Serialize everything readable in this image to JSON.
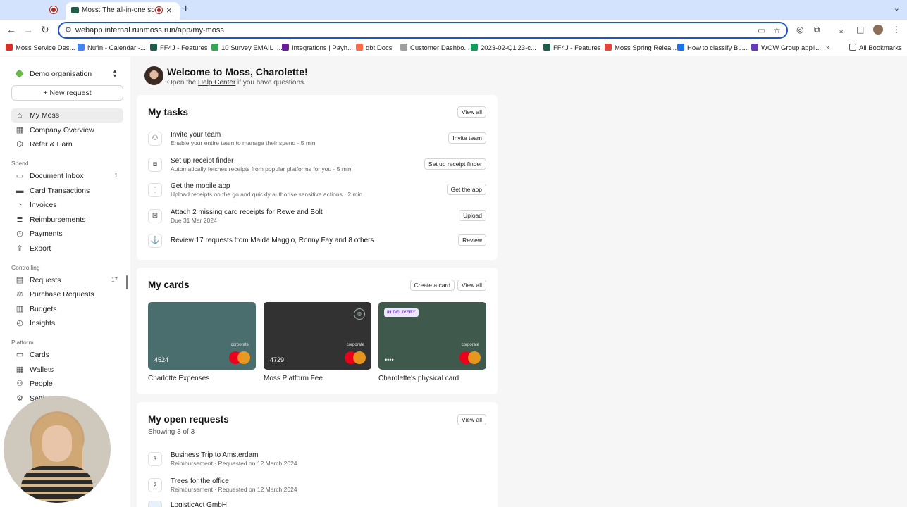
{
  "browser": {
    "tab_title": "Moss: The all-in-one spend",
    "url": "webapp.internal.runmoss.run/app/my-moss",
    "bookmarks": [
      {
        "label": "Moss Service Des...",
        "color": "#d93025"
      },
      {
        "label": "Nufin - Calendar -...",
        "color": "#4285f4"
      },
      {
        "label": "FF4J - Features",
        "color": "#1e5d4a"
      },
      {
        "label": "10 Survey EMAIL I...",
        "color": "#34a853"
      },
      {
        "label": "Integrations | Payh...",
        "color": "#6a1b9a"
      },
      {
        "label": "dbt Docs",
        "color": "#ff694a"
      },
      {
        "label": "Customer Dashbo...",
        "color": "#9e9e9e"
      },
      {
        "label": "2023-02-Q1'23-c...",
        "color": "#0f9d58"
      },
      {
        "label": "FF4J - Features",
        "color": "#1e5d4a"
      },
      {
        "label": "Moss Spring Relea...",
        "color": "#e8453c"
      },
      {
        "label": "How to classify Bu...",
        "color": "#1a73e8"
      },
      {
        "label": "WOW Group appli...",
        "color": "#673ab7"
      }
    ],
    "all_bookmarks": "All Bookmarks",
    "more_bookmarks": "»"
  },
  "sidebar": {
    "org_name": "Demo organisation",
    "new_request": "New request",
    "main_items": [
      {
        "label": "My Moss",
        "icon": "home"
      },
      {
        "label": "Company Overview",
        "icon": "building"
      },
      {
        "label": "Refer & Earn",
        "icon": "gift"
      }
    ],
    "spend_label": "Spend",
    "spend_items": [
      {
        "label": "Document Inbox",
        "count": "1"
      },
      {
        "label": "Card Transactions"
      },
      {
        "label": "Invoices"
      },
      {
        "label": "Reimbursements"
      },
      {
        "label": "Payments"
      },
      {
        "label": "Export"
      }
    ],
    "controlling_label": "Controlling",
    "controlling_items": [
      {
        "label": "Requests",
        "count": "17"
      },
      {
        "label": "Purchase Requests"
      },
      {
        "label": "Budgets"
      },
      {
        "label": "Insights"
      }
    ],
    "platform_label": "Platform",
    "platform_items": [
      {
        "label": "Cards"
      },
      {
        "label": "Wallets"
      },
      {
        "label": "People"
      },
      {
        "label": "Settings"
      }
    ]
  },
  "welcome": {
    "title": "Welcome to Moss, Charolette!",
    "sub_before": "Open the ",
    "sub_link": "Help Center",
    "sub_after": " if you have questions."
  },
  "tasks": {
    "title": "My tasks",
    "view_all": "View all",
    "items": [
      {
        "title": "Invite your team",
        "subtitle": "Enable your entire team to manage their spend · 5 min",
        "action": "Invite team"
      },
      {
        "title": "Set up receipt finder",
        "subtitle": "Automatically fetches receipts from popular platforms for you · 5 min",
        "action": "Set up receipt finder"
      },
      {
        "title": "Get the mobile app",
        "subtitle": "Upload receipts on the go and quickly authorise sensitive actions · 2 min",
        "action": "Get the app"
      },
      {
        "title_prefix": "Attach 2 missing card receipts for ",
        "title_bold": "Rewe and Bolt",
        "subtitle": "Due 31 Mar 2024",
        "action": "Upload"
      },
      {
        "title_prefix": "Review 17 requests from ",
        "title_bold": "Maida Maggio, Ronny Fay and 8 others",
        "action": "Review"
      }
    ]
  },
  "cards": {
    "title": "My cards",
    "create": "Create a card",
    "view_all": "View all",
    "items": [
      {
        "name": "Charlotte Expenses",
        "number": "4524",
        "brand": "corporate",
        "color": "#4a6e6e"
      },
      {
        "name": "Moss Platform Fee",
        "number": "4729",
        "brand": "corporate",
        "color": "#323232"
      },
      {
        "name": "Charolette's physical card",
        "number": "••••",
        "brand": "corporate",
        "badge": "IN DELIVERY",
        "color": "#3f5a4c"
      }
    ]
  },
  "requests": {
    "title": "My open requests",
    "showing": "Showing 3 of 3",
    "view_all": "View all",
    "items": [
      {
        "num": "3",
        "title": "Business Trip to Amsterdam",
        "subtitle": "Reimbursement · Requested on 12 March 2024"
      },
      {
        "num": "2",
        "title": "Trees for the office",
        "subtitle": "Reimbursement · Requested on 12 March 2024"
      },
      {
        "num": "",
        "title": "LogisticAct GmbH"
      }
    ]
  }
}
